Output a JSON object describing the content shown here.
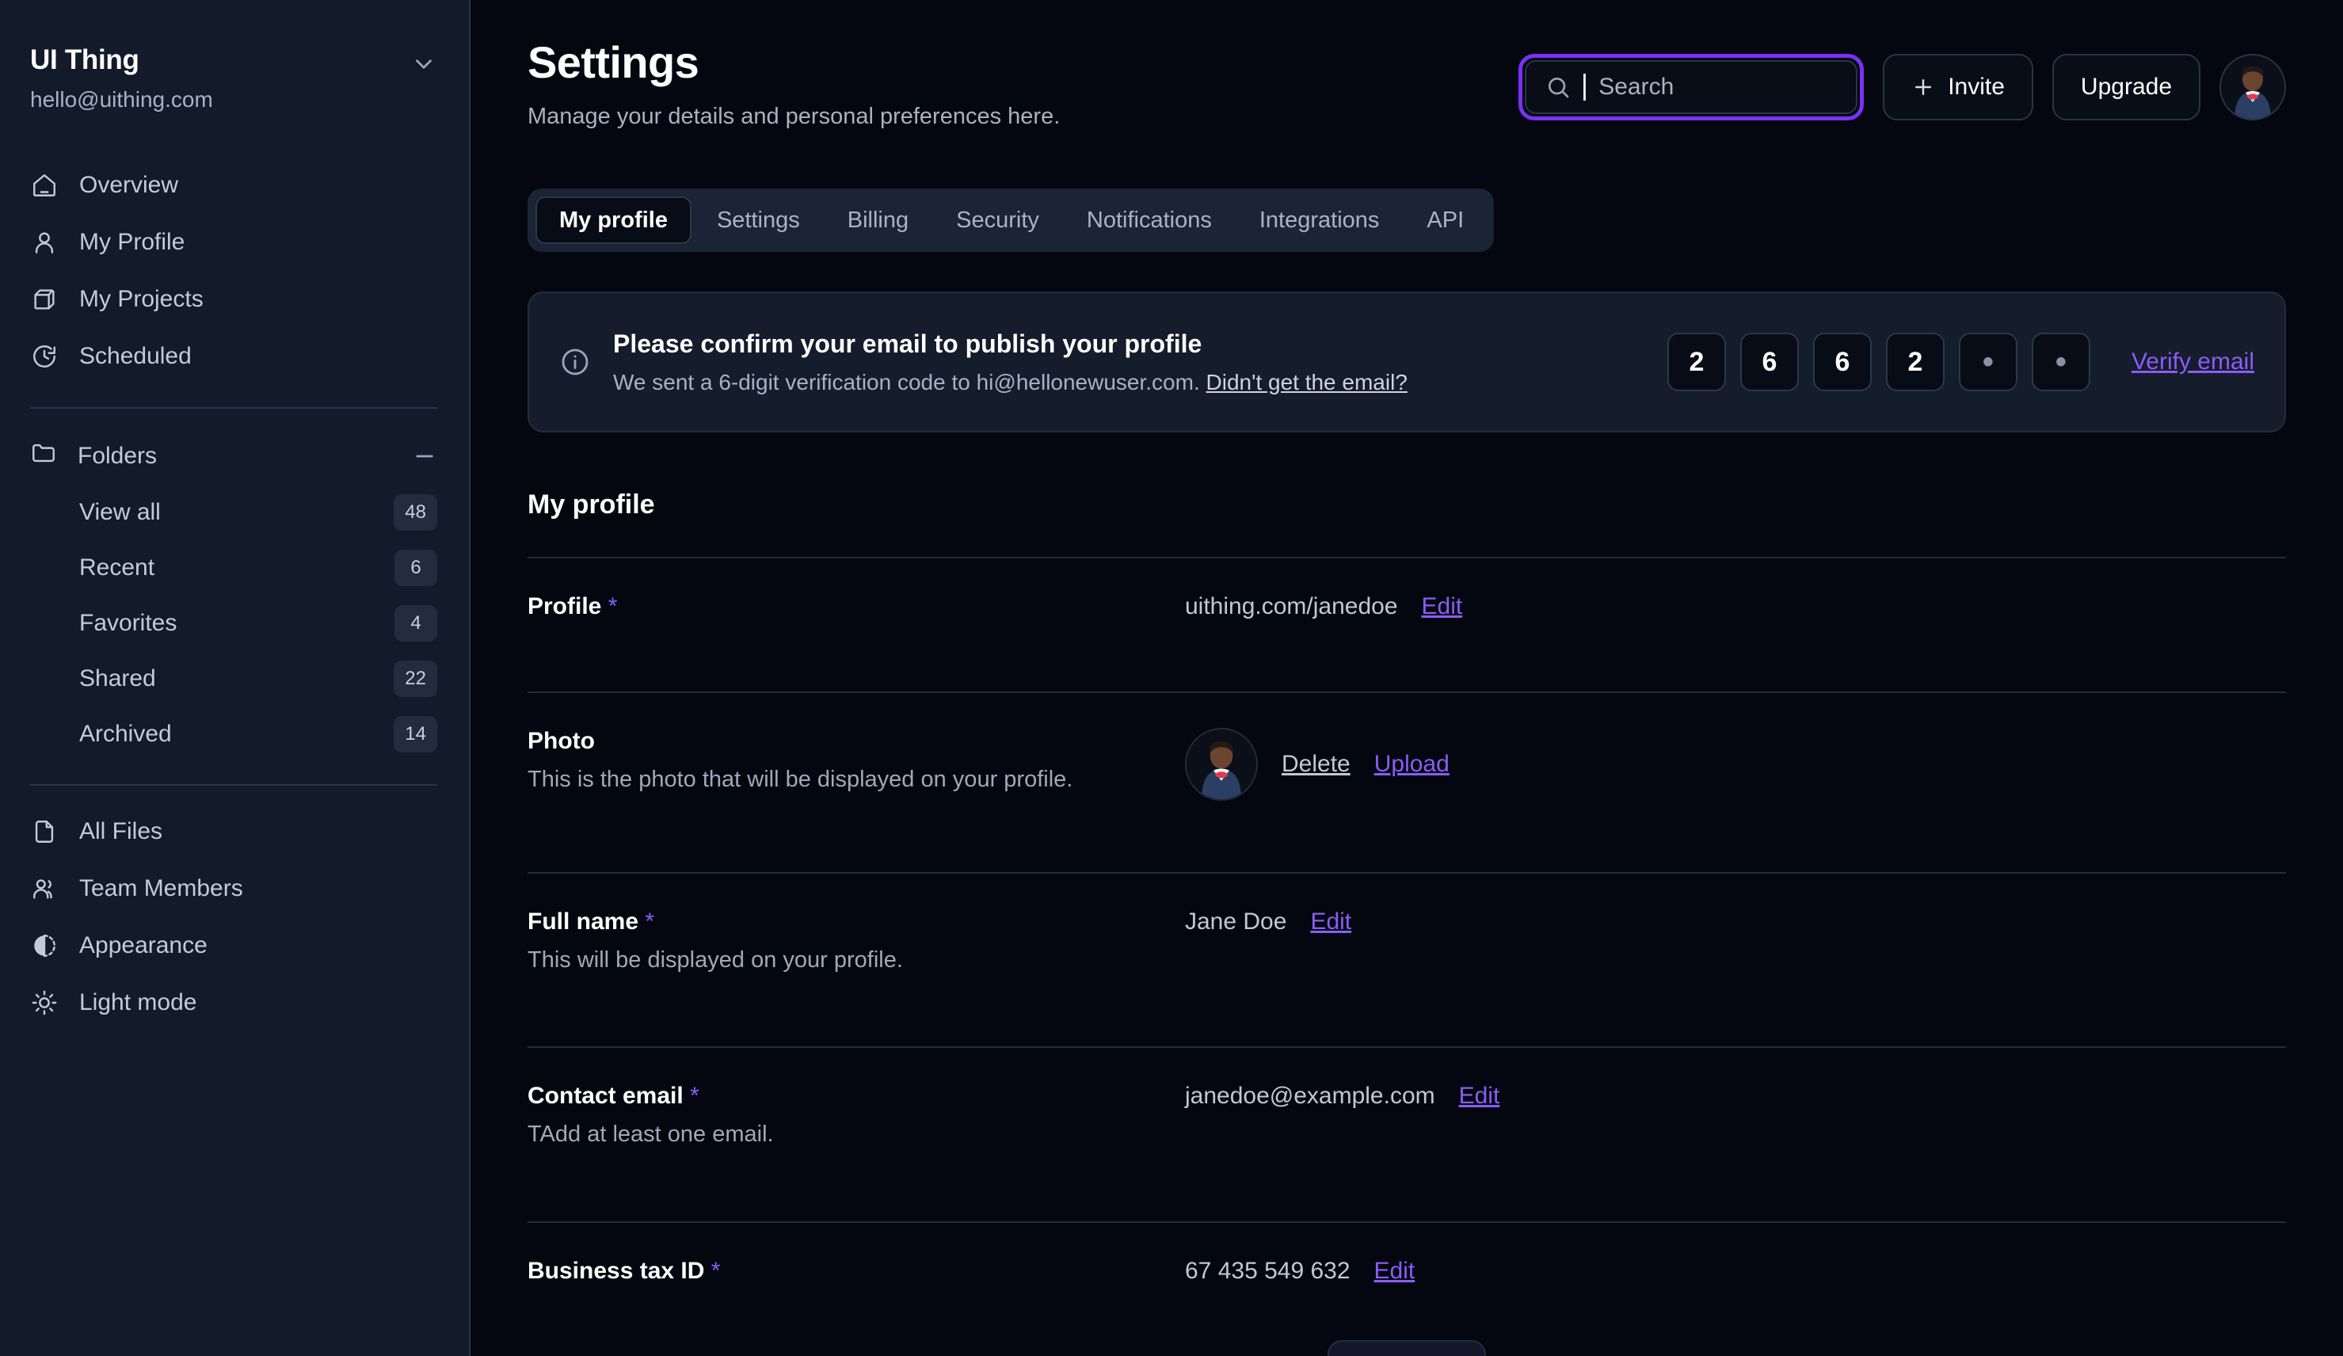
{
  "sidebar": {
    "brand": {
      "name": "UI Thing",
      "email": "hello@uithing.com",
      "chevron_icon": "chevron-down-icon"
    },
    "nav": [
      {
        "label": "Overview",
        "icon": "home-icon"
      },
      {
        "label": "My Profile",
        "icon": "user-icon"
      },
      {
        "label": "My Projects",
        "icon": "box-icon"
      },
      {
        "label": "Scheduled",
        "icon": "clock-refresh-icon"
      }
    ],
    "folders": {
      "label": "Folders",
      "icon": "folder-icon",
      "collapse_icon": "minus-icon"
    },
    "folder_items": [
      {
        "label": "View all",
        "count": "48"
      },
      {
        "label": "Recent",
        "count": "6"
      },
      {
        "label": "Favorites",
        "count": "4"
      },
      {
        "label": "Shared",
        "count": "22"
      },
      {
        "label": "Archived",
        "count": "14"
      }
    ],
    "nav_bottom": [
      {
        "label": "All Files",
        "icon": "file-icon"
      },
      {
        "label": "Team Members",
        "icon": "users-icon"
      },
      {
        "label": "Appearance",
        "icon": "contrast-icon"
      },
      {
        "label": "Light mode",
        "icon": "sun-icon"
      }
    ]
  },
  "header": {
    "title": "Settings",
    "subtitle": "Manage your details and personal preferences here.",
    "search": {
      "placeholder": "Search",
      "icon": "search-icon",
      "focused": true
    },
    "invite_label": "Invite",
    "invite_icon": "plus-icon",
    "upgrade_label": "Upgrade",
    "avatar": "user-avatar"
  },
  "tabs": [
    {
      "label": "My profile",
      "active": true
    },
    {
      "label": "Settings",
      "active": false
    },
    {
      "label": "Billing",
      "active": false
    },
    {
      "label": "Security",
      "active": false
    },
    {
      "label": "Notifications",
      "active": false
    },
    {
      "label": "Integrations",
      "active": false
    },
    {
      "label": "API",
      "active": false
    }
  ],
  "banner": {
    "icon": "info-circle-icon",
    "title": "Please confirm your email to publish your profile",
    "subtitle_prefix": "We sent a 6-digit verification code to hi@hellonewuser.com.",
    "resend_link": "Didn't get the email?",
    "otp": [
      "2",
      "6",
      "6",
      "2",
      "•",
      "•"
    ],
    "verify_label": "Verify email"
  },
  "profile": {
    "section_title": "My profile",
    "rows": [
      {
        "label": "Profile",
        "required": "*",
        "desc": "",
        "value": "uithing.com/janedoe",
        "action": "Edit",
        "type": "text"
      },
      {
        "label": "Photo",
        "required": "",
        "desc": "This is the photo that will be displayed on your profile.",
        "value": "",
        "action": "Upload",
        "secondary_action": "Delete",
        "type": "photo"
      },
      {
        "label": "Full name",
        "required": "*",
        "desc": "This will be displayed on your profile.",
        "value": "Jane Doe",
        "action": "Edit",
        "type": "text"
      },
      {
        "label": "Contact email",
        "required": "*",
        "desc": "TAdd at least one email.",
        "value": "janedoe@example.com",
        "action": "Edit",
        "type": "text"
      },
      {
        "label": "Business tax ID",
        "required": "*",
        "desc": "",
        "value": "67 435 549 632",
        "action": "Edit",
        "type": "text"
      }
    ]
  },
  "colors": {
    "accent": "#8b5cf6",
    "focus_ring": "#7b2ff7",
    "sidebar_bg": "#131a29",
    "main_bg": "#04070f"
  }
}
